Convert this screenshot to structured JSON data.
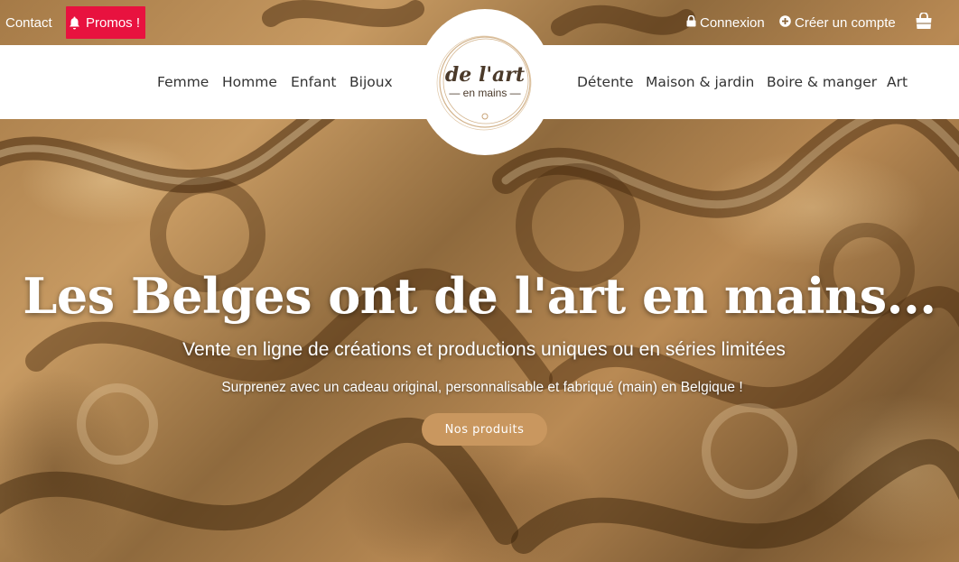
{
  "topbar": {
    "contact": "Contact",
    "promos": "Promos !",
    "login": "Connexion",
    "signup": "Créer un compte",
    "promo_color": "#e8123f"
  },
  "icons": {
    "promos": "bell-icon",
    "login": "lock-icon",
    "signup": "plus-circle-icon",
    "cart": "shopping-bag-icon"
  },
  "nav": {
    "left": [
      "Femme",
      "Homme",
      "Enfant",
      "Bijoux"
    ],
    "right": [
      "Détente",
      "Maison & jardin",
      "Boire & manger",
      "Art"
    ]
  },
  "logo": {
    "title": "de l'art",
    "subtitle": "— en mains —"
  },
  "hero": {
    "title": "Les Belges ont de l'art en mains...",
    "subtitle": "Vente en ligne de créations et productions uniques ou en séries limitées",
    "tagline": "Surprenez avec un cadeau original, personnalisable et fabriqué (main) en Belgique !",
    "cta": "Nos produits",
    "cta_color": "#c9975f"
  }
}
